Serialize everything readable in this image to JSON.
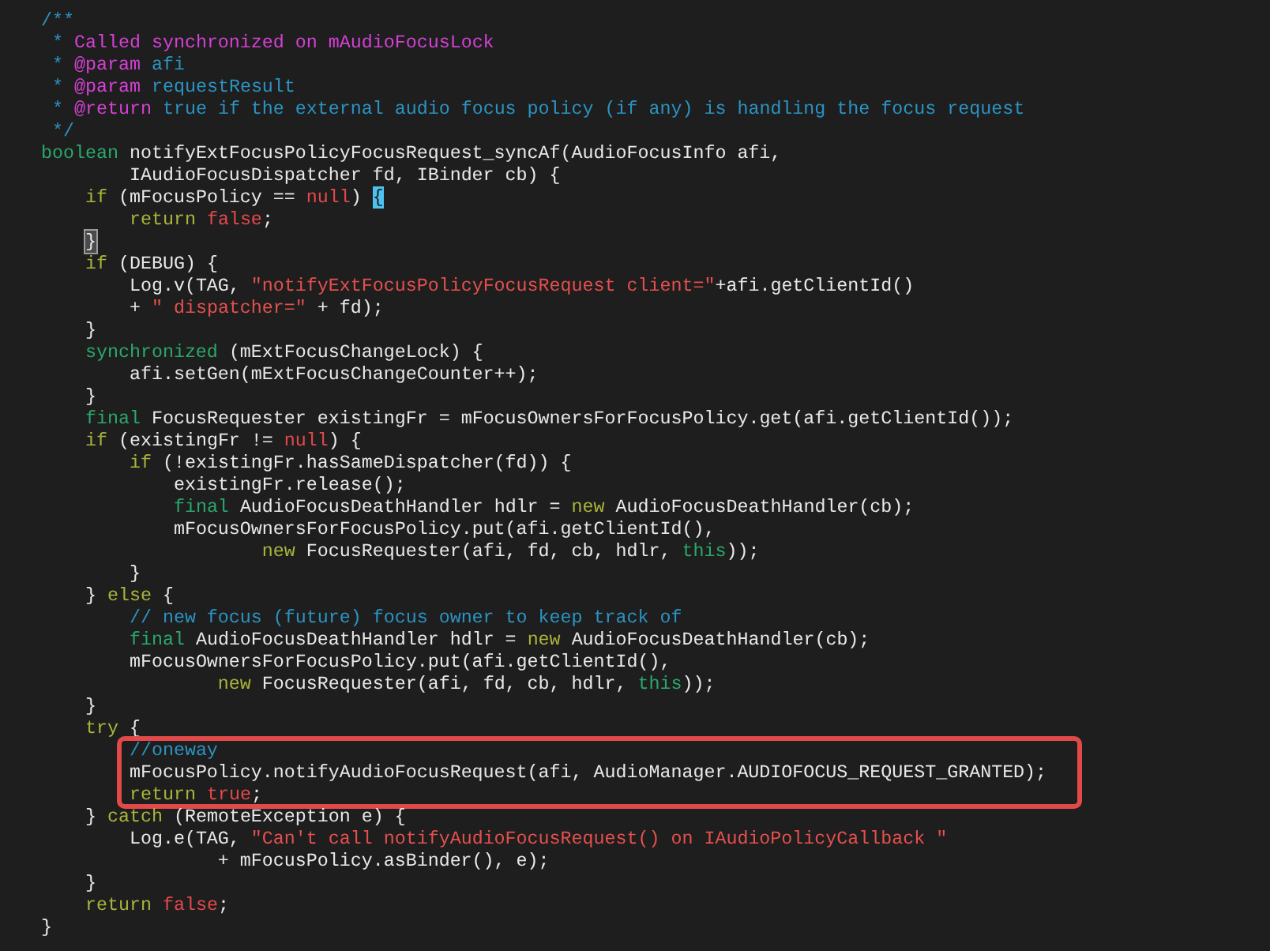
{
  "code": {
    "segments": [
      {
        "kind": "plain",
        "lines": [
          {
            "tokens": [
              {
                "kind": "comment",
                "text": "/**"
              }
            ]
          },
          {
            "tokens": [
              {
                "kind": "comment",
                "text": " * "
              },
              {
                "kind": "doc",
                "text": "Called synchronized on mAudioFocusLock"
              }
            ]
          },
          {
            "tokens": [
              {
                "kind": "comment",
                "text": " * "
              },
              {
                "kind": "doc",
                "text": "@param"
              },
              {
                "kind": "comment",
                "text": " afi"
              }
            ]
          },
          {
            "tokens": [
              {
                "kind": "comment",
                "text": " * "
              },
              {
                "kind": "doc",
                "text": "@param"
              },
              {
                "kind": "comment",
                "text": " requestResult"
              }
            ]
          },
          {
            "tokens": [
              {
                "kind": "comment",
                "text": " * "
              },
              {
                "kind": "doc",
                "text": "@return"
              },
              {
                "kind": "comment",
                "text": " true if the external audio focus policy (if any) is handling the focus request"
              }
            ]
          },
          {
            "tokens": [
              {
                "kind": "comment",
                "text": " */"
              }
            ]
          },
          {
            "tokens": [
              {
                "kind": "type",
                "text": "boolean"
              },
              {
                "kind": "plain",
                "text": " notifyExtFocusPolicyFocusRequest_syncAf(AudioFocusInfo afi,"
              }
            ]
          },
          {
            "tokens": [
              {
                "kind": "plain",
                "text": "        IAudioFocusDispatcher fd, IBinder cb) {"
              }
            ]
          },
          {
            "tokens": [
              {
                "kind": "keyword",
                "text": "    if"
              },
              {
                "kind": "plain",
                "text": " (mFocusPolicy == "
              },
              {
                "kind": "literal",
                "text": "null"
              },
              {
                "kind": "plain",
                "text": ") "
              },
              {
                "kind": "cursor-bracket",
                "text": "{"
              }
            ]
          },
          {
            "tokens": [
              {
                "kind": "keyword",
                "text": "        return"
              },
              {
                "kind": "literal",
                "text": " false"
              },
              {
                "kind": "plain",
                "text": ";"
              }
            ]
          },
          {
            "tokens": [
              {
                "kind": "matched-bracket",
                "text": "    }"
              }
            ]
          },
          {
            "tokens": [
              {
                "kind": "keyword",
                "text": "    if"
              },
              {
                "kind": "plain",
                "text": " (DEBUG) {"
              }
            ]
          },
          {
            "tokens": [
              {
                "kind": "plain",
                "text": "        Log.v(TAG, "
              },
              {
                "kind": "string",
                "text": "\"notifyExtFocusPolicyFocusRequest client=\""
              },
              {
                "kind": "plain",
                "text": "+afi.getClientId()"
              }
            ]
          },
          {
            "tokens": [
              {
                "kind": "plain",
                "text": "        + "
              },
              {
                "kind": "string",
                "text": "\" dispatcher=\""
              },
              {
                "kind": "plain",
                "text": " + fd);"
              }
            ]
          },
          {
            "tokens": [
              {
                "kind": "plain",
                "text": "    }"
              }
            ]
          },
          {
            "tokens": [
              {
                "kind": "type",
                "text": "    synchronized"
              },
              {
                "kind": "plain",
                "text": " (mExtFocusChangeLock) {"
              }
            ]
          },
          {
            "tokens": [
              {
                "kind": "plain",
                "text": "        afi.setGen(mExtFocusChangeCounter++);"
              }
            ]
          },
          {
            "tokens": [
              {
                "kind": "plain",
                "text": "    }"
              }
            ]
          },
          {
            "tokens": [
              {
                "kind": "type",
                "text": "    final"
              },
              {
                "kind": "plain",
                "text": " FocusRequester existingFr = mFocusOwnersForFocusPolicy.get(afi.getClientId());"
              }
            ]
          },
          {
            "tokens": [
              {
                "kind": "keyword",
                "text": "    if"
              },
              {
                "kind": "plain",
                "text": " (existingFr != "
              },
              {
                "kind": "literal",
                "text": "null"
              },
              {
                "kind": "plain",
                "text": ") {"
              }
            ]
          },
          {
            "tokens": [
              {
                "kind": "keyword",
                "text": "        if"
              },
              {
                "kind": "plain",
                "text": " (!existingFr.hasSameDispatcher(fd)) {"
              }
            ]
          },
          {
            "tokens": [
              {
                "kind": "plain",
                "text": "            existingFr.release();"
              }
            ]
          },
          {
            "tokens": [
              {
                "kind": "type",
                "text": "            final"
              },
              {
                "kind": "plain",
                "text": " AudioFocusDeathHandler hdlr = "
              },
              {
                "kind": "keyword",
                "text": "new"
              },
              {
                "kind": "plain",
                "text": " AudioFocusDeathHandler(cb);"
              }
            ]
          },
          {
            "tokens": [
              {
                "kind": "plain",
                "text": "            mFocusOwnersForFocusPolicy.put(afi.getClientId(),"
              }
            ]
          },
          {
            "tokens": [
              {
                "kind": "keyword",
                "text": "                    new"
              },
              {
                "kind": "plain",
                "text": " FocusRequester(afi, fd, cb, hdlr, "
              },
              {
                "kind": "type",
                "text": "this"
              },
              {
                "kind": "plain",
                "text": "));"
              }
            ]
          },
          {
            "tokens": [
              {
                "kind": "plain",
                "text": "        }"
              }
            ]
          },
          {
            "tokens": [
              {
                "kind": "plain",
                "text": "    } "
              },
              {
                "kind": "keyword",
                "text": "else"
              },
              {
                "kind": "plain",
                "text": " {"
              }
            ]
          },
          {
            "tokens": [
              {
                "kind": "comment",
                "text": "        // new focus (future) focus owner to keep track of"
              }
            ]
          },
          {
            "tokens": [
              {
                "kind": "type",
                "text": "        final"
              },
              {
                "kind": "plain",
                "text": " AudioFocusDeathHandler hdlr = "
              },
              {
                "kind": "keyword",
                "text": "new"
              },
              {
                "kind": "plain",
                "text": " AudioFocusDeathHandler(cb);"
              }
            ]
          },
          {
            "tokens": [
              {
                "kind": "plain",
                "text": "        mFocusOwnersForFocusPolicy.put(afi.getClientId(),"
              }
            ]
          },
          {
            "tokens": [
              {
                "kind": "keyword",
                "text": "                new"
              },
              {
                "kind": "plain",
                "text": " FocusRequester(afi, fd, cb, hdlr, "
              },
              {
                "kind": "type",
                "text": "this"
              },
              {
                "kind": "plain",
                "text": "));"
              }
            ]
          },
          {
            "tokens": [
              {
                "kind": "plain",
                "text": "    }"
              }
            ]
          },
          {
            "tokens": [
              {
                "kind": "keyword",
                "text": "    try"
              },
              {
                "kind": "plain",
                "text": " {"
              }
            ]
          }
        ]
      },
      {
        "kind": "highlight-box",
        "lines": [
          {
            "tokens": [
              {
                "kind": "comment",
                "text": "        //oneway"
              }
            ]
          },
          {
            "tokens": [
              {
                "kind": "plain",
                "text": "        mFocusPolicy.notifyAudioFocusRequest(afi, AudioManager.AUDIOFOCUS_REQUEST_GRANTED);"
              }
            ]
          },
          {
            "tokens": [
              {
                "kind": "keyword",
                "text": "        return"
              },
              {
                "kind": "literal",
                "text": " true"
              },
              {
                "kind": "plain",
                "text": ";"
              }
            ]
          }
        ]
      },
      {
        "kind": "plain",
        "lines": [
          {
            "tokens": [
              {
                "kind": "plain",
                "text": "    } "
              },
              {
                "kind": "keyword",
                "text": "catch"
              },
              {
                "kind": "plain",
                "text": " (RemoteException e) {"
              }
            ]
          },
          {
            "tokens": [
              {
                "kind": "plain",
                "text": "        Log.e(TAG, "
              },
              {
                "kind": "string",
                "text": "\"Can't call notifyAudioFocusRequest() on IAudioPolicyCallback \""
              }
            ]
          },
          {
            "tokens": [
              {
                "kind": "plain",
                "text": "                + mFocusPolicy.asBinder(), e);"
              }
            ]
          },
          {
            "tokens": [
              {
                "kind": "plain",
                "text": "    }"
              }
            ]
          },
          {
            "tokens": [
              {
                "kind": "keyword",
                "text": "    return"
              },
              {
                "kind": "literal",
                "text": " false"
              },
              {
                "kind": "plain",
                "text": ";"
              }
            ]
          },
          {
            "tokens": [
              {
                "kind": "plain",
                "text": "}"
              }
            ]
          }
        ]
      }
    ]
  }
}
